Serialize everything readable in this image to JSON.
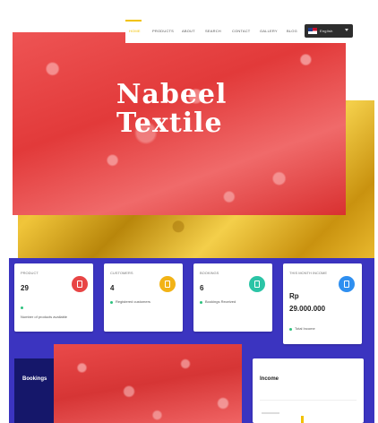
{
  "nav": {
    "items": [
      "HOME",
      "PRODUCTS",
      "ABOUT",
      "SEARCH",
      "CONTACT",
      "GALLERY",
      "BLOG"
    ],
    "active_index": 0,
    "accent_color": "#f2c200",
    "language": "English"
  },
  "hero": {
    "title_line1": "Nabeel",
    "title_line2": "Textile"
  },
  "stats": [
    {
      "label": "PRODUCT",
      "value": "29",
      "footer": "Number of products available",
      "icon": "product-icon",
      "color": "#e84545"
    },
    {
      "label": "CUSTOMERS",
      "value": "4",
      "footer": "Registered customers",
      "icon": "customers-icon",
      "color": "#f2b316"
    },
    {
      "label": "BOOKINGS",
      "value": "6",
      "footer": "Bookings Received",
      "icon": "bookings-icon",
      "color": "#2bc4a6"
    },
    {
      "label": "THIS MONTH INCOME",
      "value_prefix": "Rp",
      "value": "29.000.000",
      "footer": "Total Income",
      "icon": "income-icon",
      "color": "#2f8ff0"
    }
  ],
  "bottom": {
    "bookings_title": "Bookings",
    "income_title": "Income"
  }
}
